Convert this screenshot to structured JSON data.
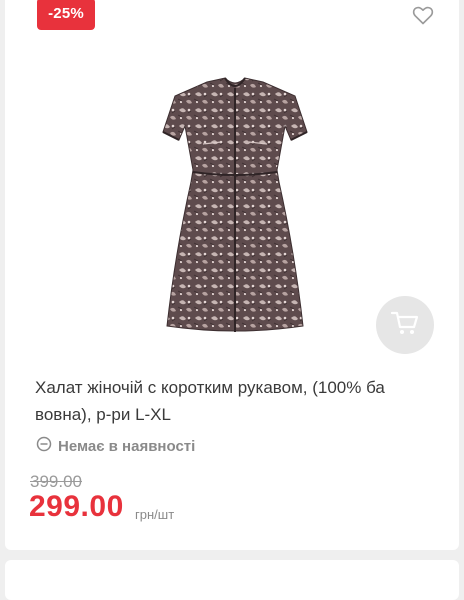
{
  "badge": {
    "discount": "-25%"
  },
  "product": {
    "title": "Халат жіночій с коротким рукавом, (100% ба вовна), р-ри L-XL",
    "stock_status": "Немає в наявності"
  },
  "price": {
    "old": "399.00",
    "current": "299.00",
    "unit": "грн/шт"
  },
  "icons": {
    "wishlist": "heart-icon",
    "cart": "cart-icon",
    "stock": "minus-circle-icon"
  },
  "colors": {
    "accent": "#e8323c",
    "muted": "#8a8a8a",
    "text": "#3a3a3a",
    "cart_button_bg": "#e6e6e6"
  }
}
